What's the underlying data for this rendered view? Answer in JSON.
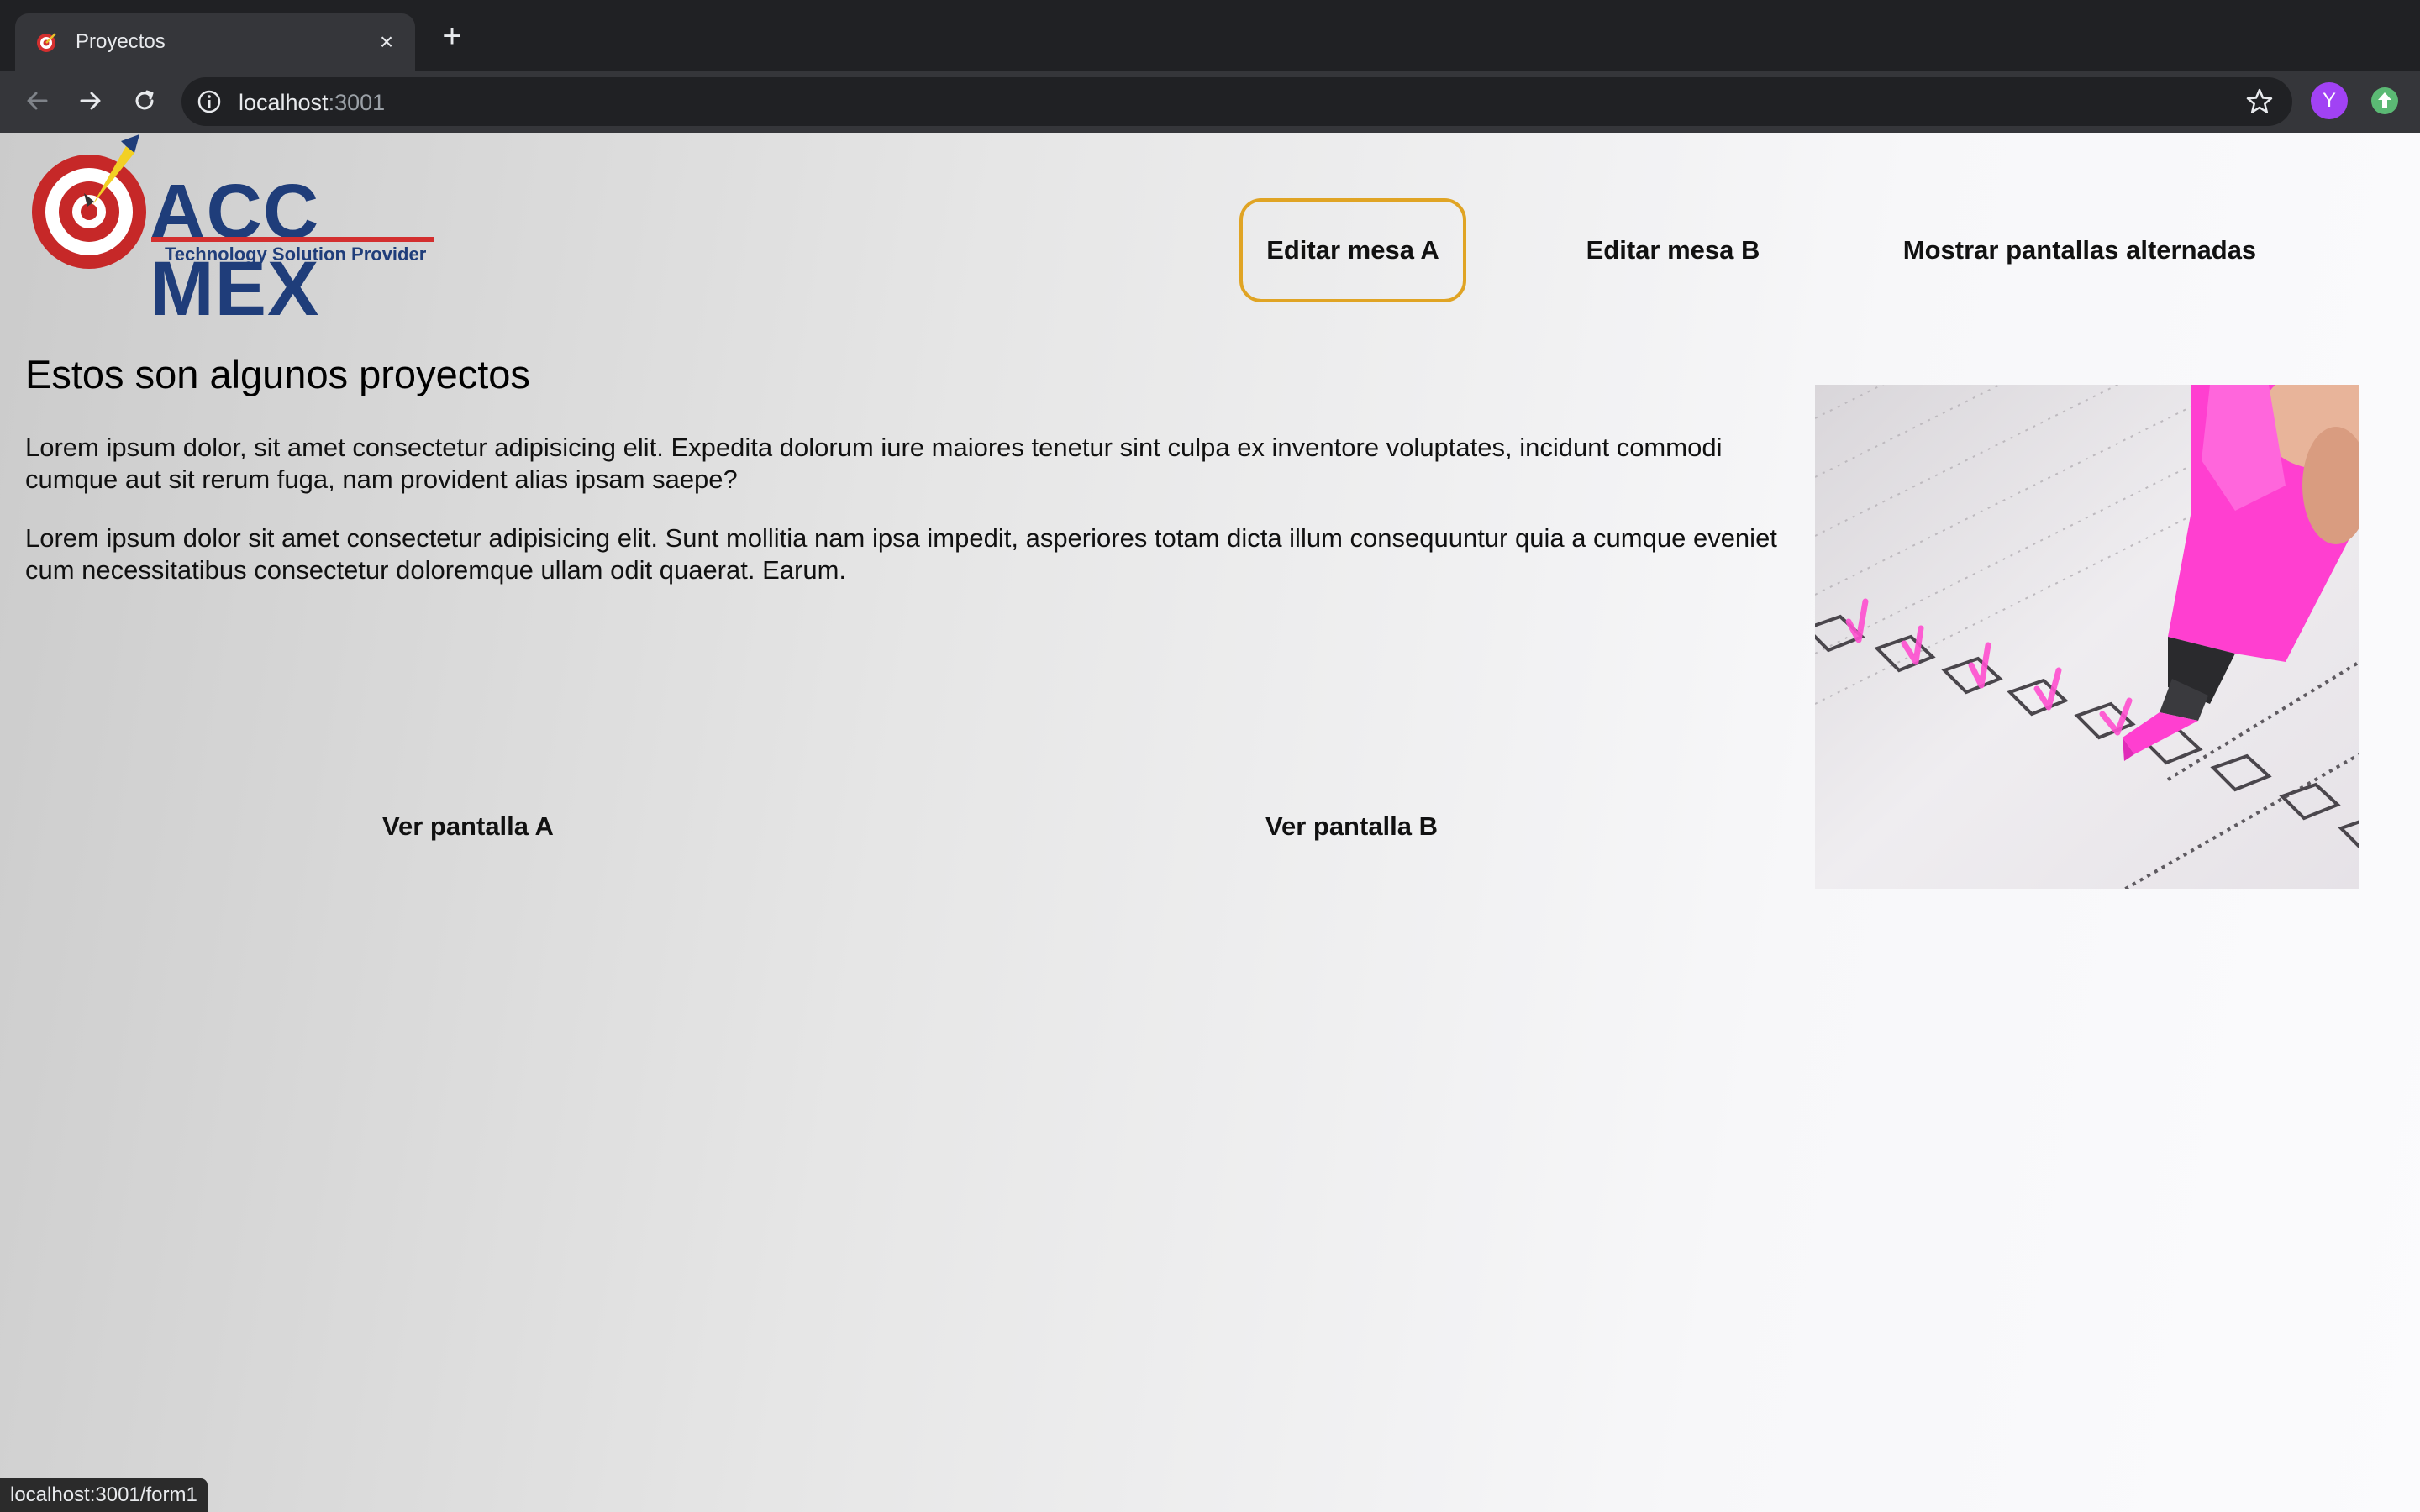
{
  "browser": {
    "tab_title": "Proyectos",
    "tab_close": "×",
    "new_tab": "+",
    "url_host": "localhost",
    "url_port": ":3001",
    "avatar_letter": "Y",
    "status_url": "localhost:3001/form1"
  },
  "logo": {
    "name": "ACC MEX",
    "tagline": "Technology Solution Provider"
  },
  "nav": {
    "items": [
      {
        "label": "Editar mesa A",
        "active": true
      },
      {
        "label": "Editar mesa B",
        "active": false
      },
      {
        "label": "Mostrar pantallas alternadas",
        "active": false
      }
    ]
  },
  "content": {
    "heading": "Estos son algunos proyectos",
    "paragraphs": [
      "Lorem ipsum dolor, sit amet consectetur adipisicing elit. Expedita dolorum iure maiores tenetur sint culpa ex inventore voluptates, incidunt commodi cumque aut sit rerum fuga, nam provident alias ipsam saepe?",
      "Lorem ipsum dolor sit amet consectetur adipisicing elit. Sunt mollitia nam ipsa impedit, asperiores totam dicta illum consequuntur quia a cumque eveniet cum necessitatibus consectetur doloremque ullam odit quaerat. Earum."
    ],
    "screen_links": [
      "Ver pantalla A",
      "Ver pantalla B"
    ]
  },
  "colors": {
    "active_border": "#e0a424",
    "logo_blue": "#1f3d7a",
    "logo_red": "#d32f2f",
    "highlighter": "#ff3fd0"
  }
}
